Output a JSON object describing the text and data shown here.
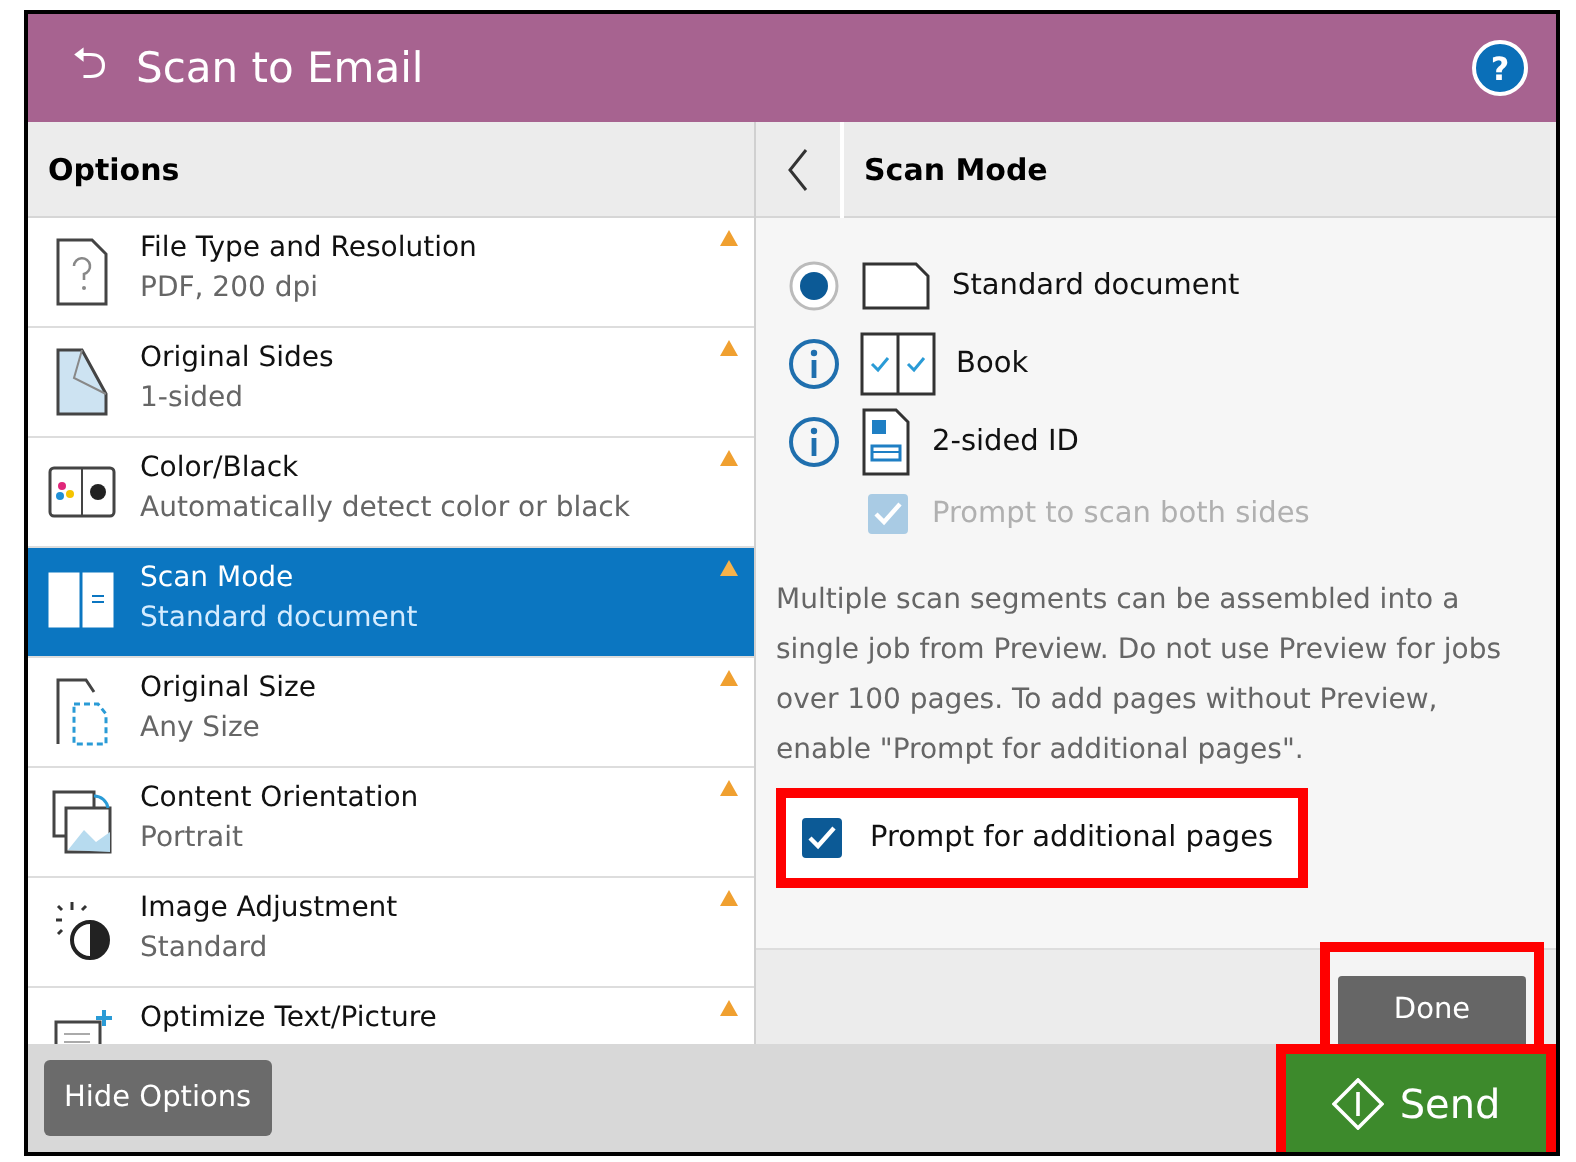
{
  "header": {
    "back_icon": "⮌",
    "title": "Scan to Email",
    "help": "?"
  },
  "options": {
    "title": "Options",
    "items": [
      {
        "title": "File Type and Resolution",
        "value": "PDF, 200 dpi",
        "selected": false
      },
      {
        "title": "Original Sides",
        "value": "1-sided",
        "selected": false
      },
      {
        "title": "Color/Black",
        "value": "Automatically detect color or black",
        "selected": false
      },
      {
        "title": "Scan Mode",
        "value": "Standard document",
        "selected": true
      },
      {
        "title": "Original Size",
        "value": "Any Size",
        "selected": false
      },
      {
        "title": "Content Orientation",
        "value": "Portrait",
        "selected": false
      },
      {
        "title": "Image Adjustment",
        "value": "Standard",
        "selected": false
      },
      {
        "title": "Optimize Text/Picture",
        "selected": false
      }
    ]
  },
  "detail": {
    "title": "Scan Mode",
    "modes": [
      {
        "label": "Standard document",
        "selected": true
      },
      {
        "label": "Book",
        "selected": false
      },
      {
        "label": "2-sided ID",
        "selected": false
      }
    ],
    "sub_option": {
      "label": "Prompt to scan both sides",
      "checked": true,
      "disabled": true
    },
    "note": "Multiple scan segments can be assembled into a single job from Preview. Do not use Preview for jobs over 100 pages. To add pages without Preview, enable \"Prompt for additional pages\".",
    "prompt": {
      "label": "Prompt for additional pages",
      "checked": true,
      "highlighted": true
    },
    "done": {
      "label": "Done",
      "highlighted": true
    }
  },
  "footer": {
    "hide_options": "Hide Options",
    "send": {
      "label": "Send",
      "highlighted": true
    }
  }
}
